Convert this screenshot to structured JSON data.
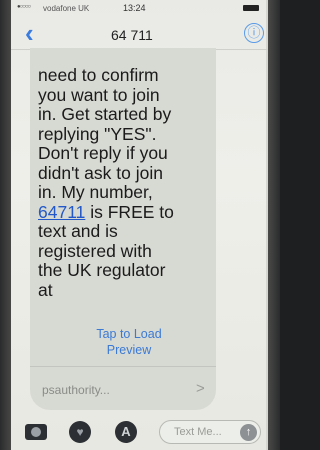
{
  "status_bar": {
    "signal": "●○○○○",
    "carrier": "vodafone UK",
    "time": "13:24"
  },
  "nav": {
    "back_icon": "chevron-left",
    "contact": "64 711",
    "info_icon": "ⓘ"
  },
  "message": {
    "text_before": "need to confirm\nyou want to join\nin. Get started by\nreplying \"YES\".\nDon't reply if you\ndidn't ask to join\nin. My number,\n",
    "link": "64711",
    "text_after": " is FREE to\ntext and is\nregistered with\nthe UK regulator\nat"
  },
  "preview": {
    "tap_label": "Tap to Load Preview",
    "link_text": "psauthority...",
    "chevron": ">"
  },
  "input": {
    "placeholder": "Text Me..."
  }
}
